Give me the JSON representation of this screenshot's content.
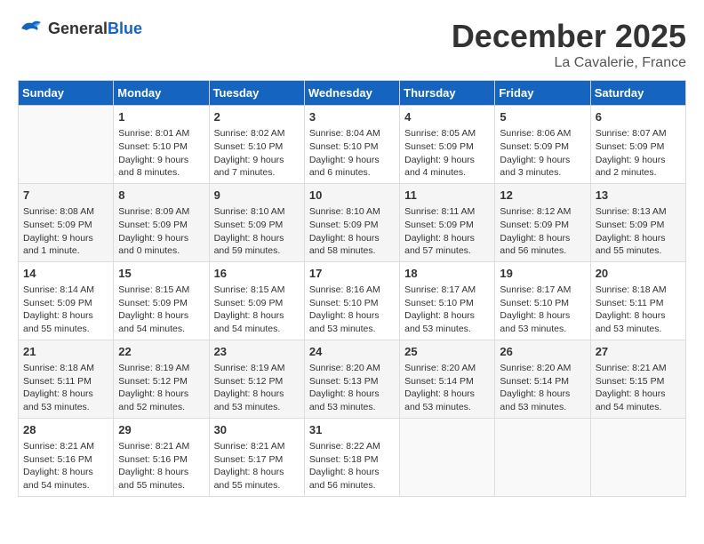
{
  "header": {
    "logo_general": "General",
    "logo_blue": "Blue",
    "month_title": "December 2025",
    "location": "La Cavalerie, France"
  },
  "days_of_week": [
    "Sunday",
    "Monday",
    "Tuesday",
    "Wednesday",
    "Thursday",
    "Friday",
    "Saturday"
  ],
  "weeks": [
    [
      {
        "day": "",
        "info": ""
      },
      {
        "day": "1",
        "info": "Sunrise: 8:01 AM\nSunset: 5:10 PM\nDaylight: 9 hours\nand 8 minutes."
      },
      {
        "day": "2",
        "info": "Sunrise: 8:02 AM\nSunset: 5:10 PM\nDaylight: 9 hours\nand 7 minutes."
      },
      {
        "day": "3",
        "info": "Sunrise: 8:04 AM\nSunset: 5:10 PM\nDaylight: 9 hours\nand 6 minutes."
      },
      {
        "day": "4",
        "info": "Sunrise: 8:05 AM\nSunset: 5:09 PM\nDaylight: 9 hours\nand 4 minutes."
      },
      {
        "day": "5",
        "info": "Sunrise: 8:06 AM\nSunset: 5:09 PM\nDaylight: 9 hours\nand 3 minutes."
      },
      {
        "day": "6",
        "info": "Sunrise: 8:07 AM\nSunset: 5:09 PM\nDaylight: 9 hours\nand 2 minutes."
      }
    ],
    [
      {
        "day": "7",
        "info": "Sunrise: 8:08 AM\nSunset: 5:09 PM\nDaylight: 9 hours\nand 1 minute."
      },
      {
        "day": "8",
        "info": "Sunrise: 8:09 AM\nSunset: 5:09 PM\nDaylight: 9 hours\nand 0 minutes."
      },
      {
        "day": "9",
        "info": "Sunrise: 8:10 AM\nSunset: 5:09 PM\nDaylight: 8 hours\nand 59 minutes."
      },
      {
        "day": "10",
        "info": "Sunrise: 8:10 AM\nSunset: 5:09 PM\nDaylight: 8 hours\nand 58 minutes."
      },
      {
        "day": "11",
        "info": "Sunrise: 8:11 AM\nSunset: 5:09 PM\nDaylight: 8 hours\nand 57 minutes."
      },
      {
        "day": "12",
        "info": "Sunrise: 8:12 AM\nSunset: 5:09 PM\nDaylight: 8 hours\nand 56 minutes."
      },
      {
        "day": "13",
        "info": "Sunrise: 8:13 AM\nSunset: 5:09 PM\nDaylight: 8 hours\nand 55 minutes."
      }
    ],
    [
      {
        "day": "14",
        "info": "Sunrise: 8:14 AM\nSunset: 5:09 PM\nDaylight: 8 hours\nand 55 minutes."
      },
      {
        "day": "15",
        "info": "Sunrise: 8:15 AM\nSunset: 5:09 PM\nDaylight: 8 hours\nand 54 minutes."
      },
      {
        "day": "16",
        "info": "Sunrise: 8:15 AM\nSunset: 5:09 PM\nDaylight: 8 hours\nand 54 minutes."
      },
      {
        "day": "17",
        "info": "Sunrise: 8:16 AM\nSunset: 5:10 PM\nDaylight: 8 hours\nand 53 minutes."
      },
      {
        "day": "18",
        "info": "Sunrise: 8:17 AM\nSunset: 5:10 PM\nDaylight: 8 hours\nand 53 minutes."
      },
      {
        "day": "19",
        "info": "Sunrise: 8:17 AM\nSunset: 5:10 PM\nDaylight: 8 hours\nand 53 minutes."
      },
      {
        "day": "20",
        "info": "Sunrise: 8:18 AM\nSunset: 5:11 PM\nDaylight: 8 hours\nand 53 minutes."
      }
    ],
    [
      {
        "day": "21",
        "info": "Sunrise: 8:18 AM\nSunset: 5:11 PM\nDaylight: 8 hours\nand 53 minutes."
      },
      {
        "day": "22",
        "info": "Sunrise: 8:19 AM\nSunset: 5:12 PM\nDaylight: 8 hours\nand 52 minutes."
      },
      {
        "day": "23",
        "info": "Sunrise: 8:19 AM\nSunset: 5:12 PM\nDaylight: 8 hours\nand 53 minutes."
      },
      {
        "day": "24",
        "info": "Sunrise: 8:20 AM\nSunset: 5:13 PM\nDaylight: 8 hours\nand 53 minutes."
      },
      {
        "day": "25",
        "info": "Sunrise: 8:20 AM\nSunset: 5:14 PM\nDaylight: 8 hours\nand 53 minutes."
      },
      {
        "day": "26",
        "info": "Sunrise: 8:20 AM\nSunset: 5:14 PM\nDaylight: 8 hours\nand 53 minutes."
      },
      {
        "day": "27",
        "info": "Sunrise: 8:21 AM\nSunset: 5:15 PM\nDaylight: 8 hours\nand 54 minutes."
      }
    ],
    [
      {
        "day": "28",
        "info": "Sunrise: 8:21 AM\nSunset: 5:16 PM\nDaylight: 8 hours\nand 54 minutes."
      },
      {
        "day": "29",
        "info": "Sunrise: 8:21 AM\nSunset: 5:16 PM\nDaylight: 8 hours\nand 55 minutes."
      },
      {
        "day": "30",
        "info": "Sunrise: 8:21 AM\nSunset: 5:17 PM\nDaylight: 8 hours\nand 55 minutes."
      },
      {
        "day": "31",
        "info": "Sunrise: 8:22 AM\nSunset: 5:18 PM\nDaylight: 8 hours\nand 56 minutes."
      },
      {
        "day": "",
        "info": ""
      },
      {
        "day": "",
        "info": ""
      },
      {
        "day": "",
        "info": ""
      }
    ]
  ]
}
